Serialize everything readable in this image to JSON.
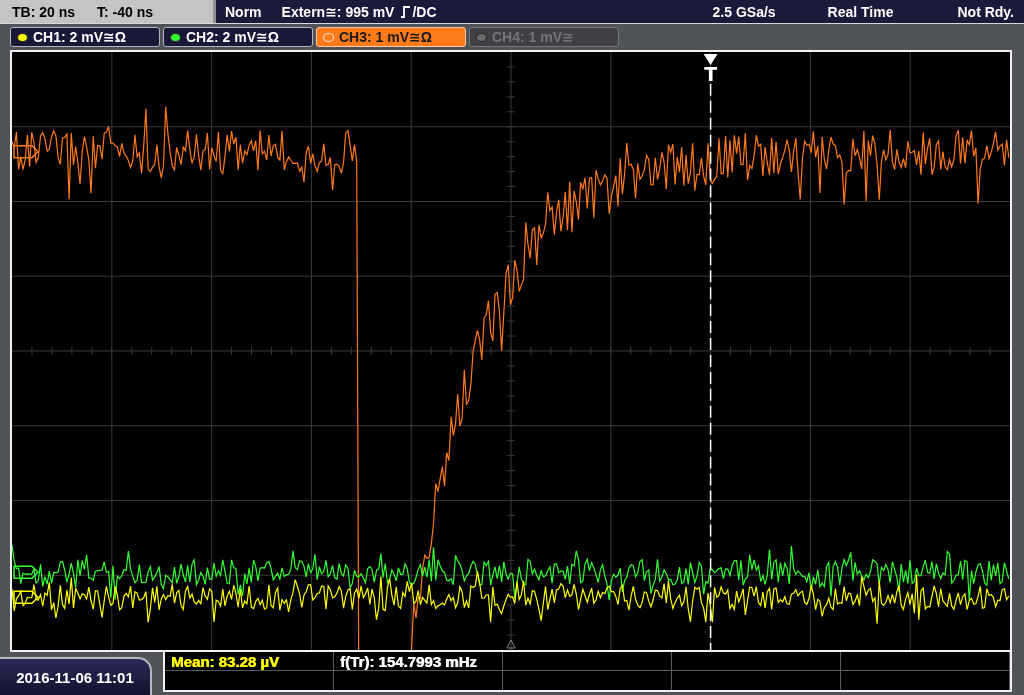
{
  "top_bar": {
    "timebase": "TB: 20 ns",
    "trigger_offset": "T: -40 ns",
    "trigger_mode": "Norm",
    "trigger_source": "Extern≅: 995 mV",
    "trigger_coupling": "/DC",
    "sample_rate": "2.5 GSa/s",
    "acquisition_mode": "Real Time",
    "status": "Not Rdy."
  },
  "channels": [
    {
      "label": "CH1: 2 mV≅Ω",
      "color": "#ffff00",
      "on": true,
      "selected": false
    },
    {
      "label": "CH2: 2 mV≅Ω",
      "color": "#33ff33",
      "on": true,
      "selected": false
    },
    {
      "label": "CH3: 1 mV≅Ω",
      "color": "#ff7a1a",
      "on": true,
      "selected": true
    },
    {
      "label": "CH4: 1 mV≅",
      "color": "#6a6a6a",
      "on": false,
      "selected": false
    }
  ],
  "display": {
    "trigger_marker": "T"
  },
  "footer": {
    "datetime": "2016-11-06 11:01",
    "measurements": [
      {
        "text": "Mean: 83.28 µV",
        "color": "#ffff00"
      },
      {
        "text": "f(Tr): 154.7993 mHz",
        "color": "#ffffff"
      }
    ]
  }
}
